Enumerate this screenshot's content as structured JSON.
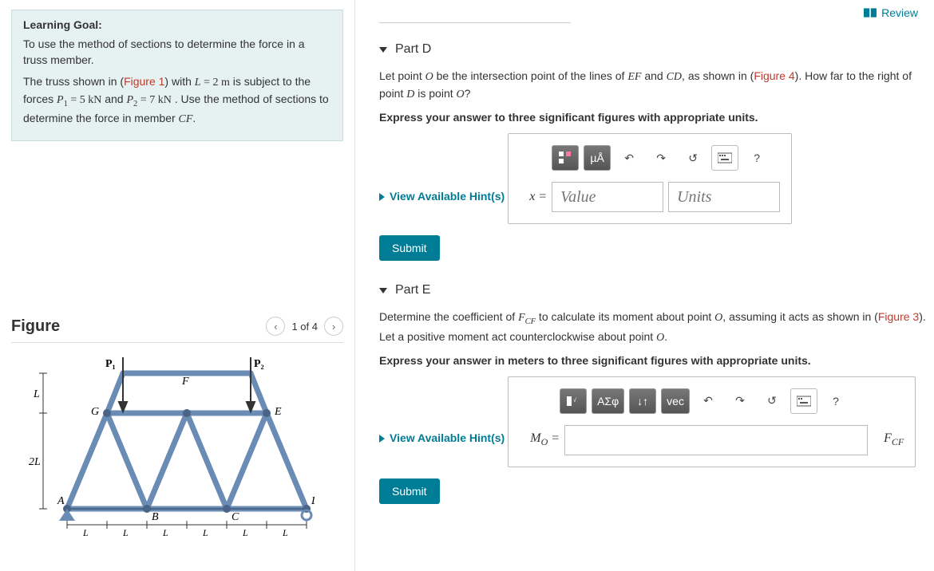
{
  "learning": {
    "title": "Learning Goal:",
    "p1": "To use the method of sections to determine the force in a truss member.",
    "p2a": "The truss shown in (",
    "p2link": "Figure 1",
    "p2b": ") with ",
    "p2c": " is subject to the forces ",
    "p2d": " and ",
    "p2e": " . Use the method of sections to determine the force in member ",
    "p2f": ".",
    "L_eq": "L = 2 m",
    "P1_eq": "P₁ = 5 kN",
    "P2_eq": "P₂ = 7 kN",
    "member": "CF"
  },
  "figure": {
    "heading": "Figure",
    "pager": "1 of 4",
    "labels": {
      "P1": "P₁",
      "P2": "P₂",
      "F": "F",
      "G": "G",
      "E": "E",
      "A": "A",
      "B": "B",
      "C": "C",
      "D": "D",
      "L": "L",
      "twoL": "2L"
    }
  },
  "review": "Review",
  "partD": {
    "title": "Part D",
    "text_a": "Let point ",
    "O": "O",
    "text_b": " be the intersection point of the lines of ",
    "EF": "EF",
    "text_c": " and ",
    "CD": "CD",
    "text_d": ", as shown in (",
    "figlink": "Figure 4",
    "text_e": "). How far to the right of point ",
    "Dpt": "D",
    "text_f": " is point ",
    "text_g": "?",
    "instruct": "Express your answer to three significant figures with appropriate units.",
    "hints": "View Available Hint(s)",
    "lhs": "x =",
    "value_ph": "Value",
    "units_ph": "Units",
    "submit": "Submit",
    "tb_units": "µÅ"
  },
  "partE": {
    "title": "Part E",
    "text_a": "Determine the coefficient of ",
    "FCF": "F",
    "FCF_sub": "CF",
    "text_b": " to calculate its moment about point ",
    "O": "O",
    "text_c": ", assuming it acts as shown in (",
    "figlink": "Figure 3",
    "text_d": "). Let a positive moment act counterclockwise about point ",
    "text_e": ".",
    "instruct": "Express your answer in meters to three significant figures with appropriate units.",
    "hints": "View Available Hint(s)",
    "lhs_a": "M",
    "lhs_sub": "O",
    "lhs_eq": " =",
    "rhs_a": "F",
    "rhs_sub": "CF",
    "submit": "Submit",
    "tb_greek": "ΑΣφ",
    "tb_vec": "vec",
    "tb_updown": "↓↑"
  }
}
